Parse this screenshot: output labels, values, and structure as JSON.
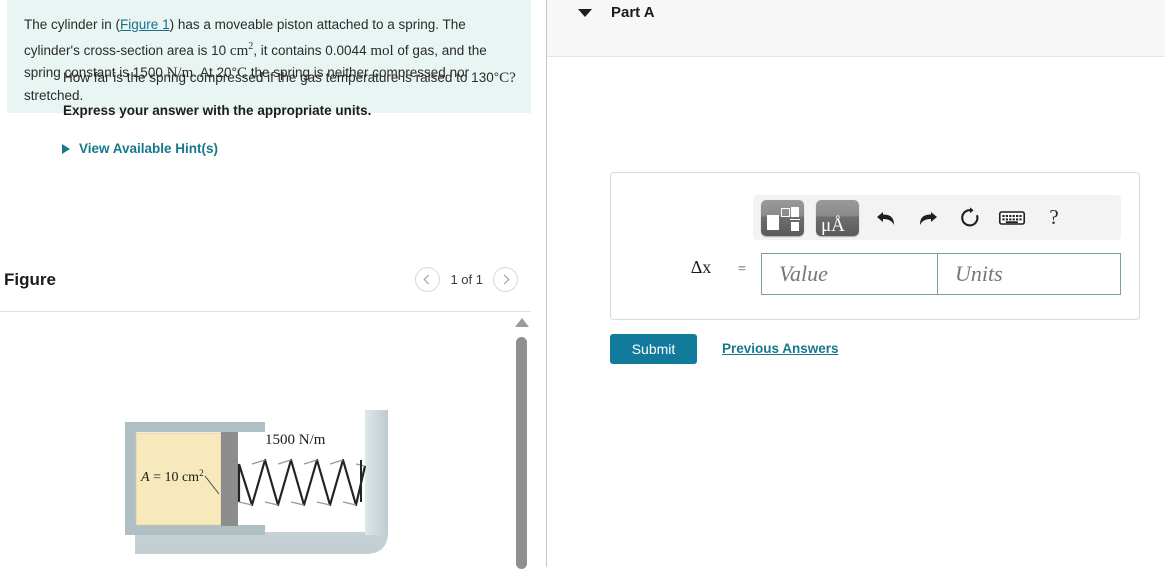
{
  "problem": {
    "text_before_link": "The cylinder in (",
    "figure_link": "Figure 1",
    "segment_1": ") has a moveable piston attached to a spring. The cylinder's cross-section area is 10 ",
    "area_unit": "cm",
    "area_exp": "2",
    "segment_2": ", it contains 0.0044 ",
    "mol_unit": "mol",
    "segment_3": " of gas, and the spring constant is 1500 ",
    "spring_unit": "N/m",
    "segment_4": ". At 20",
    "deg": "°",
    "celsius": "C",
    "segment_5": " the spring is neither compressed nor stretched."
  },
  "figure_panel": {
    "title": "Figure",
    "pager_label": "1 of 1",
    "prev_icon": "chevron-left-icon",
    "next_icon": "chevron-right-icon",
    "scroll_up_icon": "scroll-up-arrow-icon"
  },
  "diagram": {
    "area_label_var": "A",
    "area_label_eq": " = 10 cm",
    "area_label_exp": "2",
    "spring_constant_label": "1500 N/m",
    "colors": {
      "gas": "#f7e9bc",
      "cylinder_wall": "#b0bfc4",
      "piston": "#8a8a8a",
      "outer_wall": "#cfdadd",
      "spring_stroke": "#2a2a2a"
    }
  },
  "part": {
    "collapse_icon": "caret-down-icon",
    "title": "Part A",
    "question": "How far is the spring compressed if the gas temperature is raised to 130",
    "question_deg": "°",
    "question_unit": "C?",
    "express_instruction": "Express your answer with the appropriate units.",
    "hints_icon": "triangle-right-icon",
    "hints_label": "View Available Hint(s)"
  },
  "answer": {
    "toolbar": {
      "template_icon": "math-template-icon",
      "units_icon": "micro-angstrom-units-icon",
      "units_label": "μÅ",
      "undo_icon": "undo-arrow-icon",
      "redo_icon": "redo-arrow-icon",
      "reset_icon": "reset-circular-arrow-icon",
      "keyboard_icon": "keyboard-icon",
      "help_icon": "question-mark-icon",
      "help_label": "?"
    },
    "variable_label": "Δx",
    "equals_label": "=",
    "value_placeholder": "Value",
    "value_current": "",
    "units_placeholder": "Units",
    "units_current": ""
  },
  "actions": {
    "submit_label": "Submit",
    "previous_answers_label": "Previous Answers"
  },
  "theme": {
    "problem_bg": "#e8f5f3",
    "teal_link": "#17788c",
    "submit_bg": "#127a9b",
    "input_border": "#7c9fa4"
  }
}
